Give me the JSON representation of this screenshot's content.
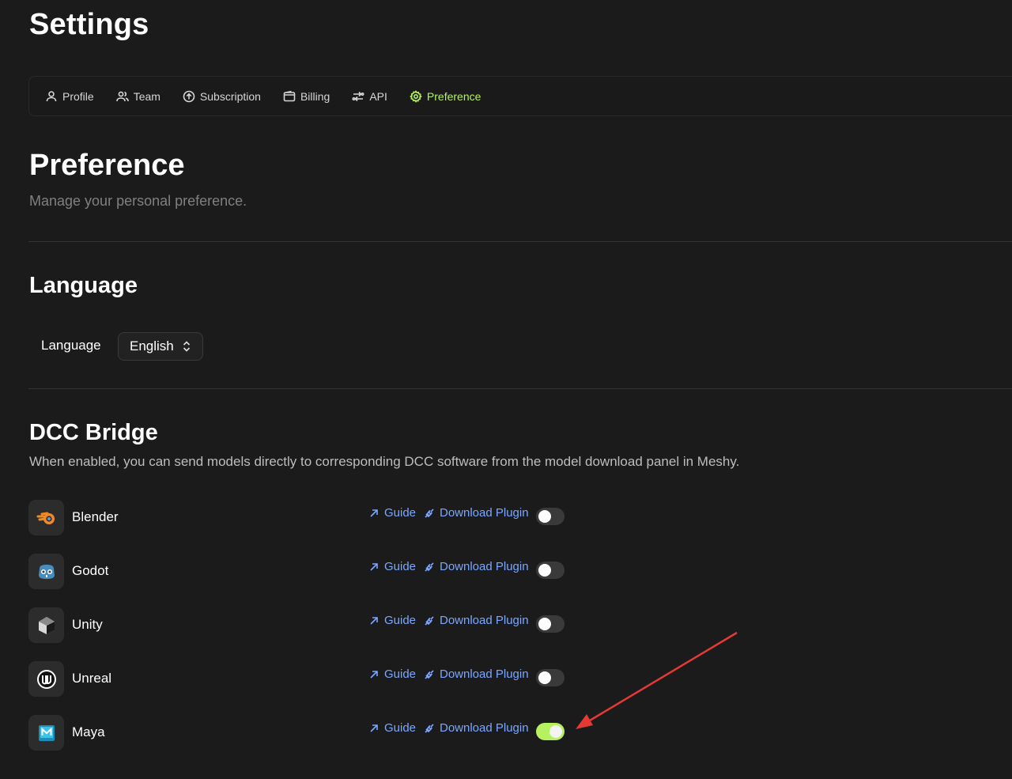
{
  "page": {
    "title": "Settings"
  },
  "tabs": [
    {
      "label": "Profile",
      "icon": "user-icon",
      "active": false
    },
    {
      "label": "Team",
      "icon": "users-icon",
      "active": false
    },
    {
      "label": "Subscription",
      "icon": "arrow-up-circle-icon",
      "active": false
    },
    {
      "label": "Billing",
      "icon": "wallet-icon",
      "active": false
    },
    {
      "label": "API",
      "icon": "api-icon",
      "active": false
    },
    {
      "label": "Preference",
      "icon": "gear-icon",
      "active": true
    }
  ],
  "preference": {
    "title": "Preference",
    "subtitle": "Manage your personal preference."
  },
  "language": {
    "title": "Language",
    "label": "Language",
    "selected": "English"
  },
  "dcc": {
    "title": "DCC Bridge",
    "description": "When enabled, you can send models directly to corresponding DCC software from the model download panel in Meshy.",
    "guide_label": "Guide",
    "download_label": "Download Plugin",
    "apps": [
      {
        "name": "Blender",
        "icon": "blender-icon",
        "enabled": false
      },
      {
        "name": "Godot",
        "icon": "godot-icon",
        "enabled": false
      },
      {
        "name": "Unity",
        "icon": "unity-icon",
        "enabled": false
      },
      {
        "name": "Unreal",
        "icon": "unreal-icon",
        "enabled": false
      },
      {
        "name": "Maya",
        "icon": "maya-icon",
        "enabled": true
      }
    ]
  },
  "colors": {
    "accent": "#b6f25f",
    "link": "#7aa7ff",
    "background": "#1b1b1b",
    "annotation_arrow": "#e53935"
  }
}
